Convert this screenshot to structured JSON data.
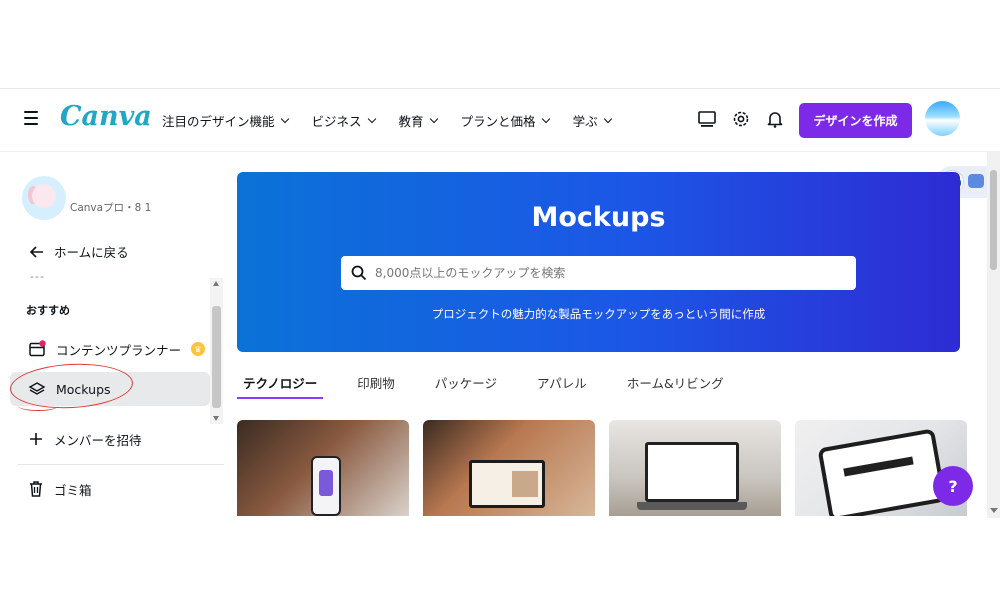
{
  "header": {
    "logo": "Canva",
    "nav": [
      {
        "label": "注目のデザイン機能"
      },
      {
        "label": "ビジネス"
      },
      {
        "label": "教育"
      },
      {
        "label": "プランと価格"
      },
      {
        "label": "学ぶ"
      }
    ],
    "create_button": "デザインを作成"
  },
  "sidebar": {
    "team_label": "Canvaプロ・8 1",
    "back_label": "ホームに戻る",
    "dashes": "---",
    "section_heading": "おすすめ",
    "items": [
      {
        "label": "コンテンツプランナー",
        "icon": "calendar-icon",
        "badge": "crown"
      },
      {
        "label": "Mockups",
        "icon": "layers-icon",
        "active": true
      },
      {
        "label": "メンバーを招待",
        "icon": "plus-icon"
      },
      {
        "label": "ゴミ箱",
        "icon": "trash-icon"
      }
    ]
  },
  "hero": {
    "title": "Mockups",
    "search_placeholder": "8,000点以上のモックアップを検索",
    "subtitle": "プロジェクトの魅力的な製品モックアップをあっという間に作成"
  },
  "tabs": [
    {
      "label": "テクノロジー",
      "active": true
    },
    {
      "label": "印刷物"
    },
    {
      "label": "パッケージ"
    },
    {
      "label": "アパレル"
    },
    {
      "label": "ホーム&リビング"
    }
  ],
  "help_button": "?",
  "colors": {
    "brand_purple": "#7d2ae8",
    "logo_teal": "#1fa7c4",
    "hero_blue": "#1c56e6",
    "annotation_red": "#e03a3a"
  }
}
